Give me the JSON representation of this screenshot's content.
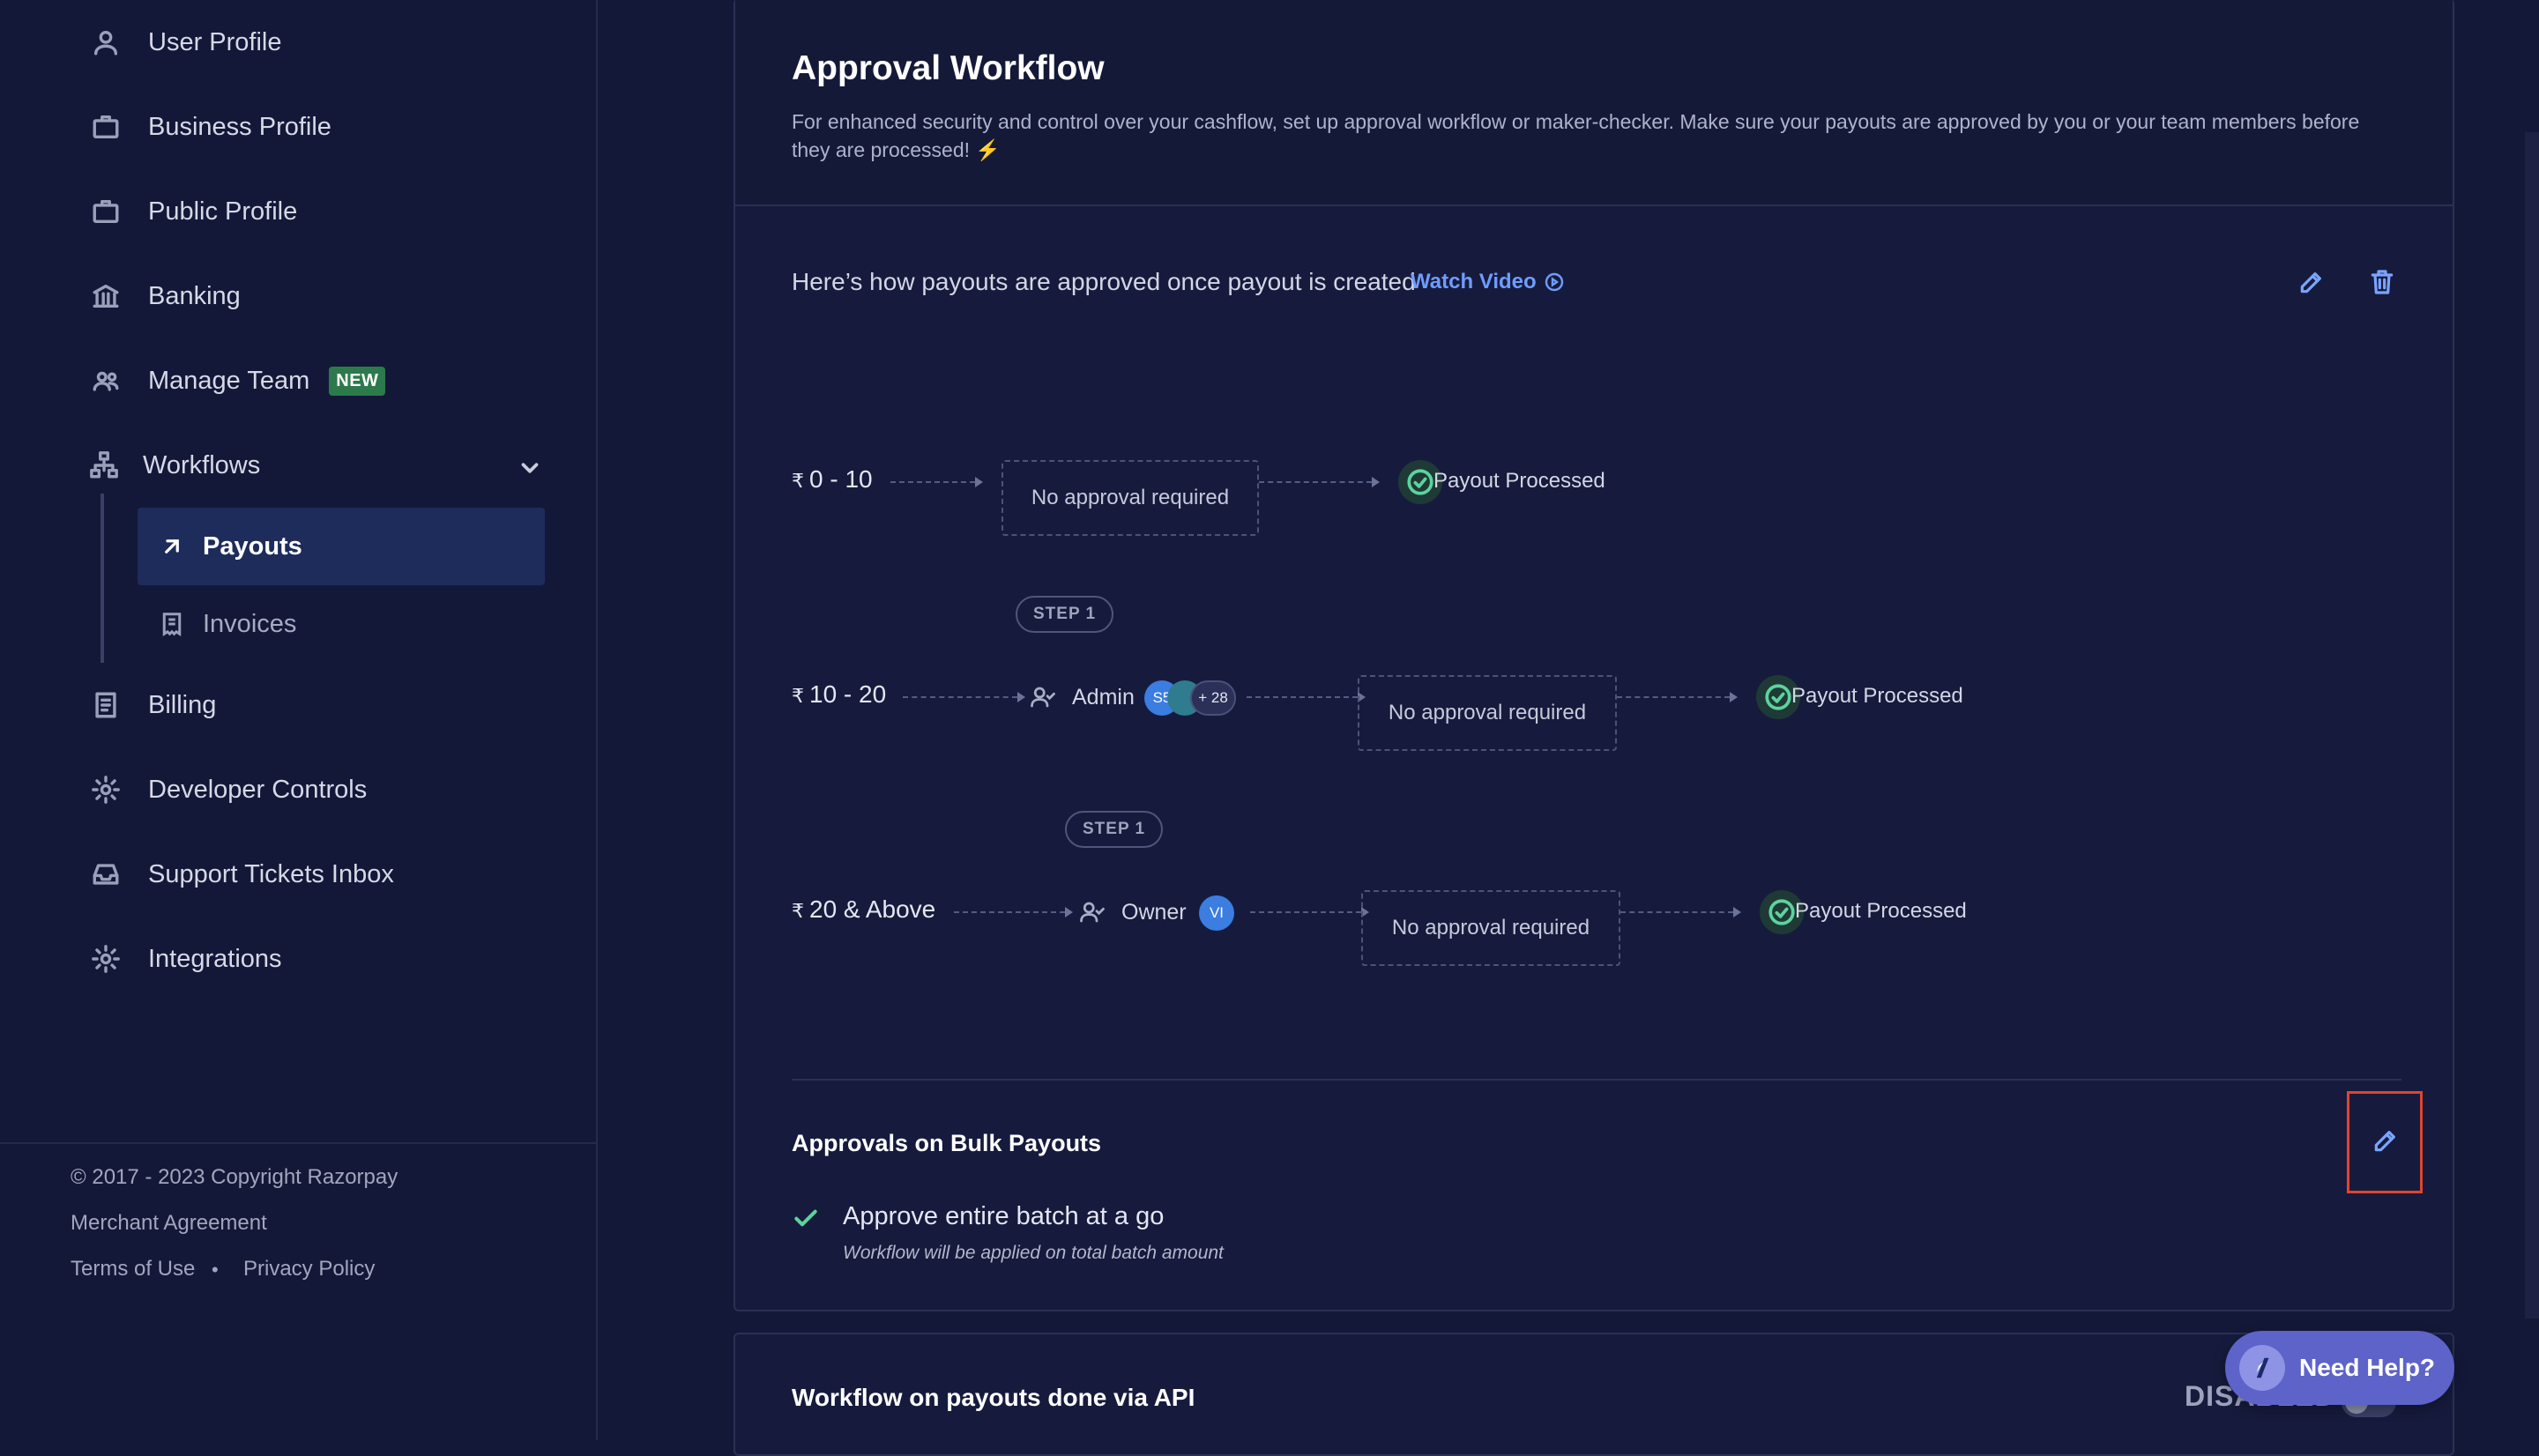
{
  "sidebar": {
    "items": [
      {
        "label": "User Profile",
        "icon": "user-icon"
      },
      {
        "label": "Business Profile",
        "icon": "briefcase-icon"
      },
      {
        "label": "Public Profile",
        "icon": "briefcase-icon"
      },
      {
        "label": "Banking",
        "icon": "bank-icon"
      },
      {
        "label": "Manage Team",
        "icon": "team-icon",
        "badge": "NEW"
      },
      {
        "label": "Workflows",
        "icon": "workflow-icon"
      },
      {
        "label": "Billing",
        "icon": "receipt-icon"
      },
      {
        "label": "Developer Controls",
        "icon": "gear-icon"
      },
      {
        "label": "Support Tickets Inbox",
        "icon": "inbox-icon"
      },
      {
        "label": "Integrations",
        "icon": "gear-icon"
      }
    ],
    "workflows_sub": [
      {
        "label": "Payouts",
        "icon": "arrow-up-right-icon",
        "active": true
      },
      {
        "label": "Invoices",
        "icon": "invoice-icon",
        "active": false
      }
    ],
    "footer": {
      "copyright": "© 2017 - 2023 Copyright Razorpay",
      "merchant_agreement": "Merchant Agreement",
      "terms": "Terms of Use",
      "separator": "•",
      "privacy": "Privacy Policy"
    }
  },
  "main": {
    "title": "Approval Workflow",
    "description": "For enhanced security and control over your cashflow, set up approval workflow or maker-checker. Make sure your payouts are approved by you or your team members before they are processed! ⚡",
    "how_text": "Here’s how payouts are approved once payout is created",
    "watch_video": "Watch Video",
    "currency": "₹",
    "rows": [
      {
        "range": "0 - 10",
        "box": "No approval required",
        "result": "Payout Processed"
      },
      {
        "step": "STEP 1",
        "range": "10 - 20",
        "role": "Admin",
        "avatars": [
          "S5",
          ""
        ],
        "more": "+ 28",
        "box": "No approval required",
        "result": "Payout Processed"
      },
      {
        "step": "STEP 1",
        "range": "20 & Above",
        "role": "Owner",
        "avatars": [
          "VI"
        ],
        "box": "No approval required",
        "result": "Payout Processed"
      }
    ],
    "bulk": {
      "title": "Approvals on Bulk Payouts",
      "option": "Approve entire batch at a go",
      "option_sub": "Workflow will be applied on total batch amount"
    },
    "api_card": {
      "title": "Workflow on payouts done via API",
      "status": "DISABLED"
    }
  },
  "help": {
    "label": "Need Help?"
  },
  "colors": {
    "background": "#141838",
    "accent": "#6f9cff",
    "success": "#5dd39e",
    "active_nav": "#1e2c5c",
    "badge_new": "#2c7a4b",
    "focus": "#e0452f",
    "help_button": "#5d63c8"
  }
}
